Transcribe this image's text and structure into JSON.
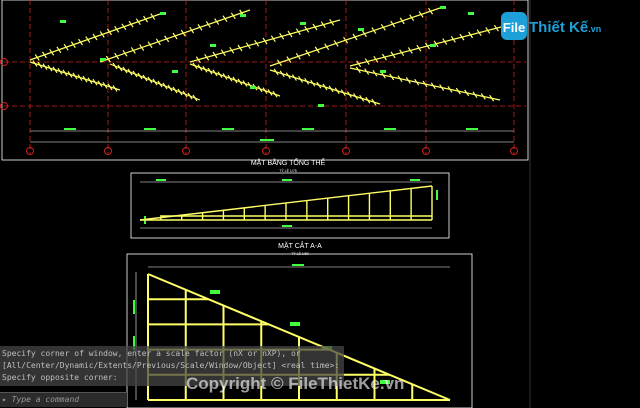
{
  "logo": {
    "brand": "FileThietKe.vn",
    "part1": "File",
    "part2": "Thiết Kế",
    "part3": ".vn"
  },
  "plan": {
    "title": "MẶT BẰNG TỔNG THỂ",
    "scale": "TỶ LỆ 1/75"
  },
  "section": {
    "title": "MẶT CẮT A-A",
    "scale": "TỶ LỆ 1/50"
  },
  "command_history": [
    "Specify corner of window, enter a scale factor (nX or nXP), or",
    "[All/Center/Dynamic/Extents/Previous/Scale/Window/Object] <real time>:",
    "Specify opposite corner:"
  ],
  "command_input": {
    "placeholder": "Type a command"
  },
  "watermark": "Copyright © FileThietKe.vn",
  "colors": {
    "background": "#000000",
    "frame": "#ffff66",
    "grid": "#d02020",
    "text": "#ffffff",
    "dimension": "#40ff40"
  }
}
